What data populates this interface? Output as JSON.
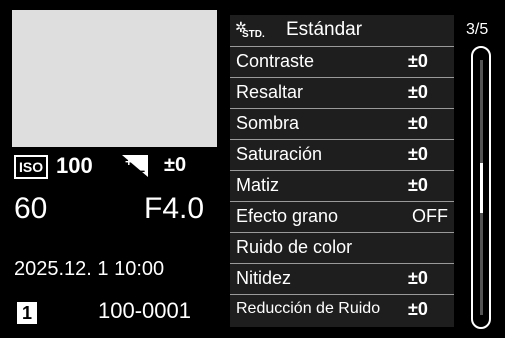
{
  "left_panel": {
    "iso_label": "ISO",
    "iso_value": "100",
    "exposure_comp": "±0",
    "shutter_speed": "60",
    "aperture": "F4.0",
    "datetime": "2025.12.  1 10:00",
    "card_slot": "1",
    "file_number": "100-0001"
  },
  "menu": {
    "header_icon": "photo-style-standard-icon",
    "header_icon_text": "STD.",
    "title": "Estándar",
    "items": [
      {
        "label": "Contraste",
        "value": "±0"
      },
      {
        "label": "Resaltar",
        "value": "±0"
      },
      {
        "label": "Sombra",
        "value": "±0"
      },
      {
        "label": "Saturación",
        "value": "±0"
      },
      {
        "label": "Matiz",
        "value": "±0"
      },
      {
        "label": "Efecto grano",
        "value": "OFF"
      },
      {
        "label": "Ruido de color",
        "value": ""
      },
      {
        "label": "Nitidez",
        "value": "±0"
      },
      {
        "label": "Reducción de Ruido",
        "value": "±0"
      }
    ]
  },
  "pagination": {
    "current": 3,
    "total": 5,
    "label": "3/5"
  }
}
